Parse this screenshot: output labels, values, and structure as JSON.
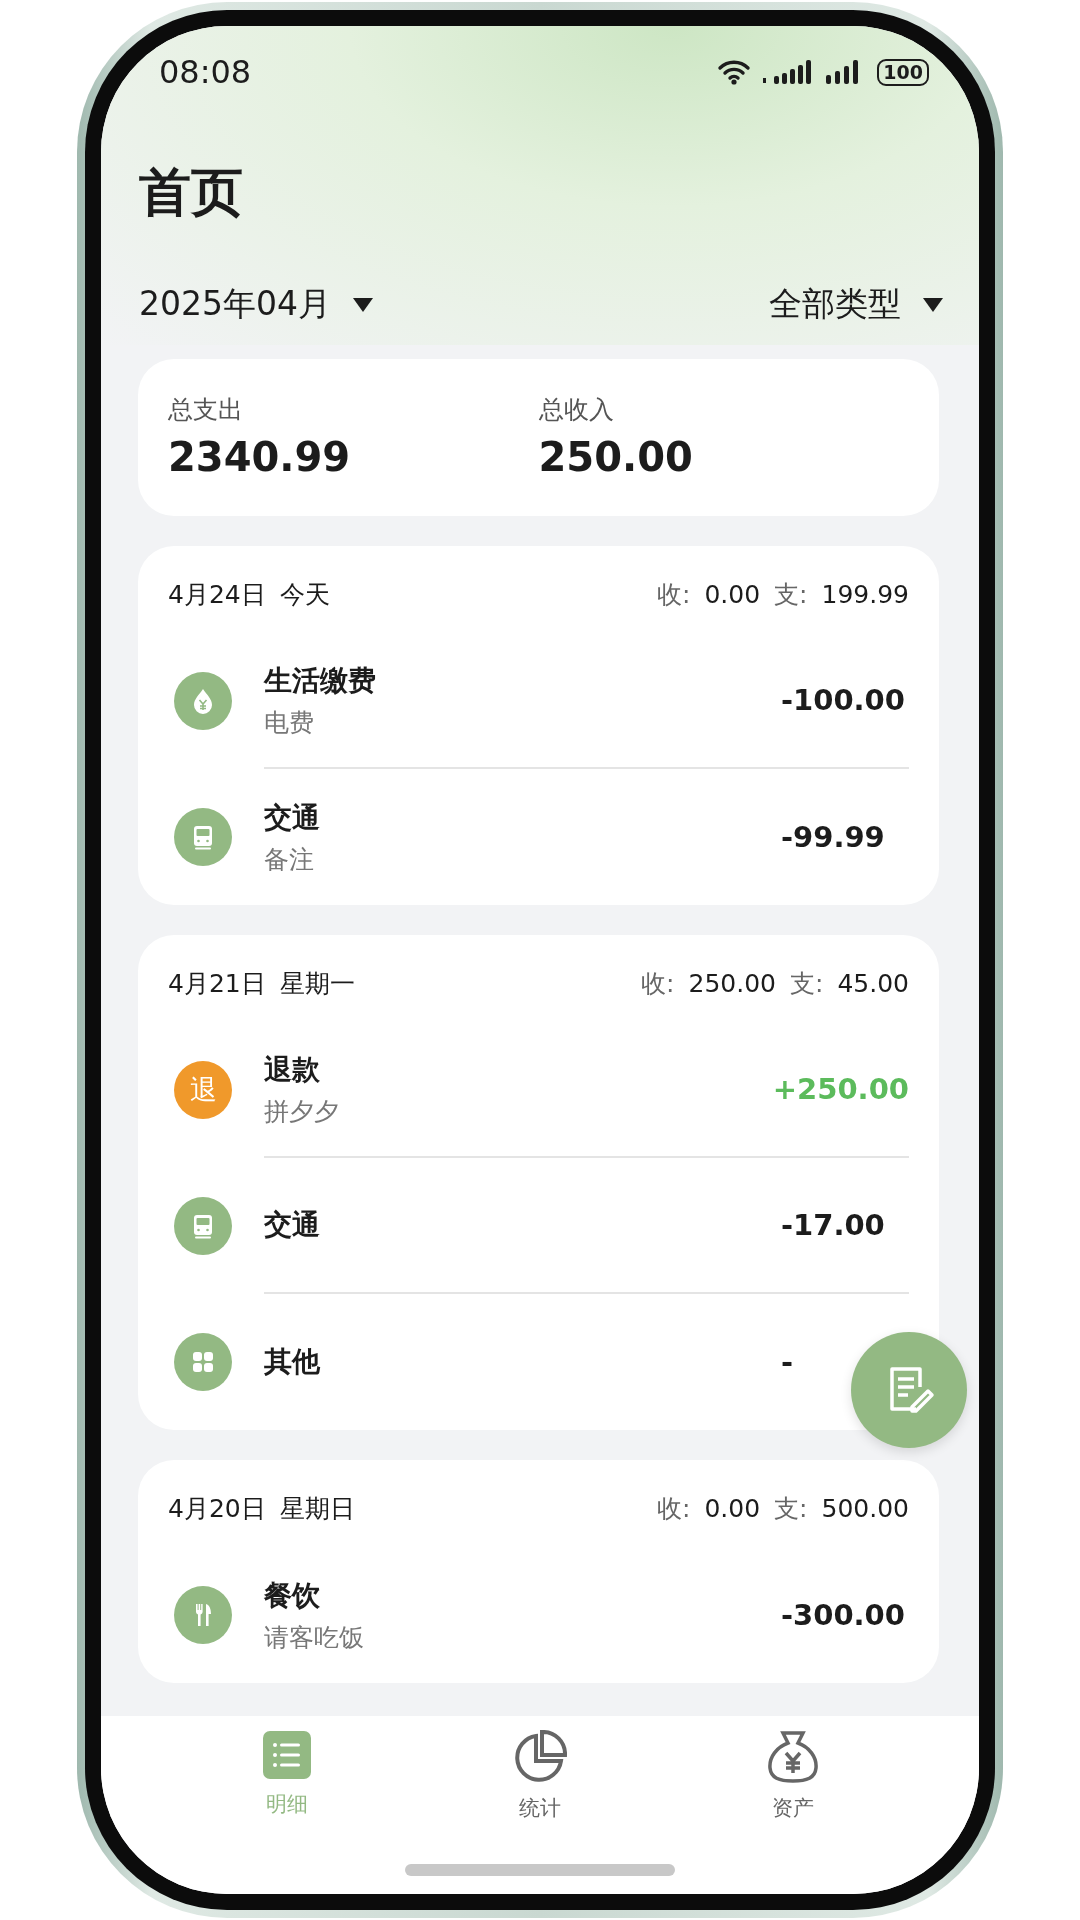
{
  "status_bar": {
    "time": "08:08",
    "battery": "100"
  },
  "title": "首页",
  "filters": {
    "month": "2025年04月",
    "category": "全部类型"
  },
  "summary": {
    "expense_label": "总支出",
    "expense": "2340.99",
    "income_label": "总收入",
    "income": "250.00"
  },
  "days": [
    {
      "date": "4月24日",
      "weekday": "今天",
      "income_label": "收:",
      "income": "0.00",
      "expense_label": "支:",
      "expense": "199.99",
      "items": [
        {
          "kind": "utility",
          "color": "#93b983",
          "title": "生活缴费",
          "note": "电费",
          "amount": "-100.00"
        },
        {
          "kind": "transport",
          "color": "#93b983",
          "title": "交通",
          "note": "备注",
          "amount": "-99.99"
        }
      ]
    },
    {
      "date": "4月21日",
      "weekday": "星期一",
      "income_label": "收:",
      "income": "250.00",
      "expense_label": "支:",
      "expense": "45.00",
      "items": [
        {
          "kind": "refund",
          "icon_text": "退",
          "color": "#f0992b",
          "title": "退款",
          "note": "拼夕夕",
          "amount": "+250.00"
        },
        {
          "kind": "transport",
          "color": "#93b983",
          "title": "交通",
          "amount": "-17.00"
        },
        {
          "kind": "other",
          "color": "#93b983",
          "title": "其他",
          "amount": "-"
        }
      ]
    },
    {
      "date": "4月20日",
      "weekday": "星期日",
      "income_label": "收:",
      "income": "0.00",
      "expense_label": "支:",
      "expense": "500.00",
      "items": [
        {
          "kind": "dining",
          "color": "#93b983",
          "title": "餐饮",
          "note": "请客吃饭",
          "amount": "-300.00"
        }
      ]
    }
  ],
  "nav": [
    {
      "label": "明细",
      "selected": true
    },
    {
      "label": "统计",
      "selected": false
    },
    {
      "label": "资产",
      "selected": false
    }
  ]
}
